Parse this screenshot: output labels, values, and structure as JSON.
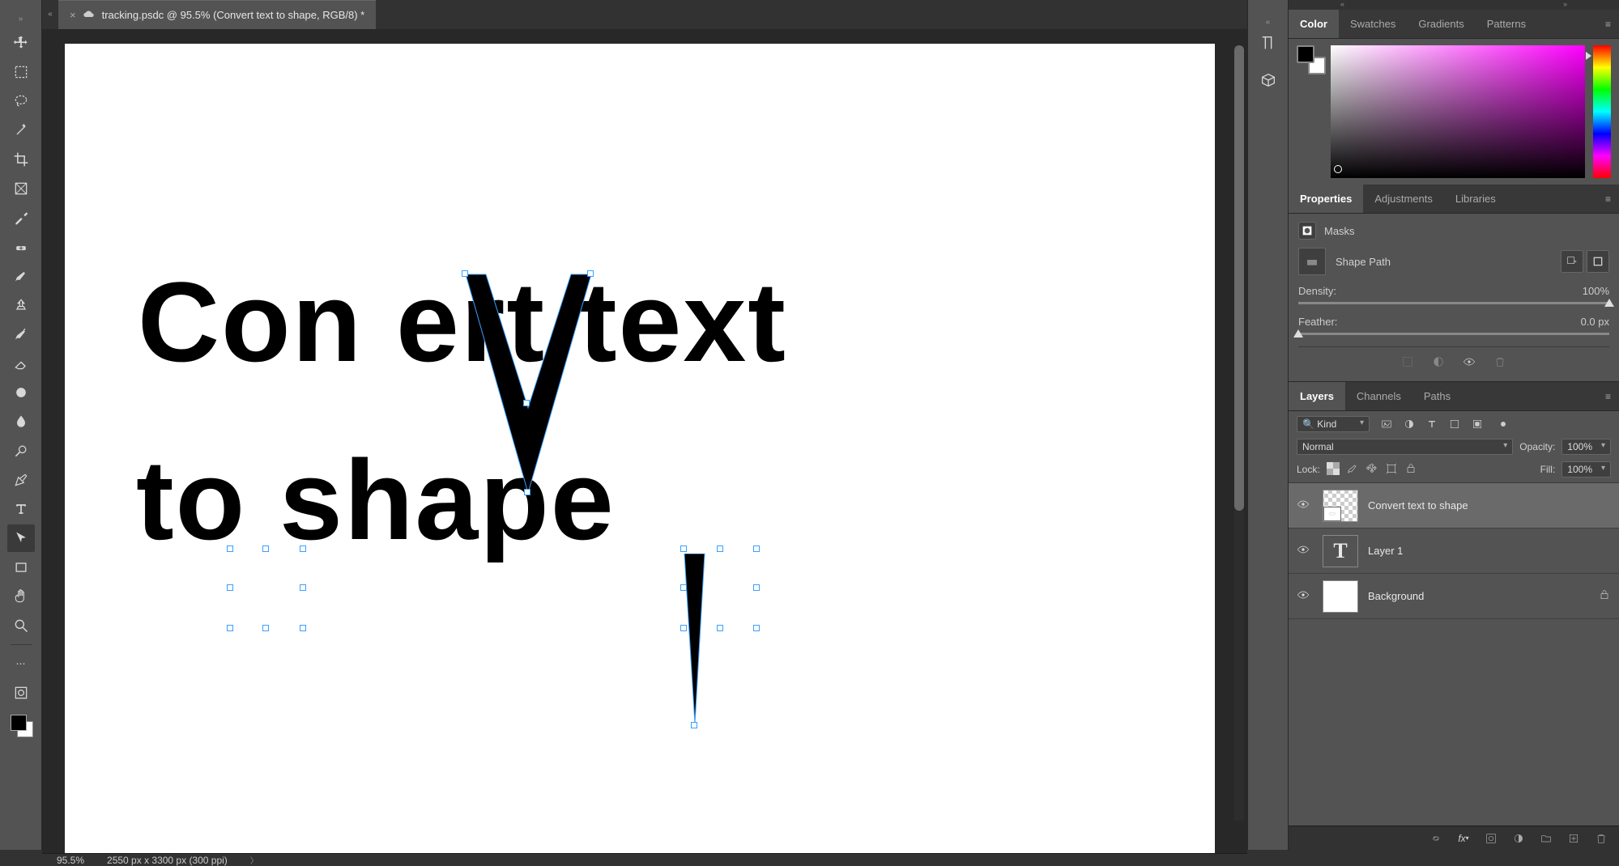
{
  "document": {
    "tab_title": "tracking.psdc @ 95.5% (Convert text to shape, RGB/8) *",
    "zoom": "95.5%",
    "dimensions": "2550 px x 3300 px (300 ppi)"
  },
  "canvas_text": {
    "line1": "Con   ert  text",
    "line2": "to  shape",
    "big_v": "V"
  },
  "color_panel": {
    "tabs": [
      "Color",
      "Swatches",
      "Gradients",
      "Patterns"
    ],
    "active": "Color"
  },
  "properties_panel": {
    "tabs": [
      "Properties",
      "Adjustments",
      "Libraries"
    ],
    "active": "Properties",
    "section": "Masks",
    "shape_label": "Shape Path",
    "density": {
      "label": "Density:",
      "value": "100%"
    },
    "feather": {
      "label": "Feather:",
      "value": "0.0 px"
    }
  },
  "layers_panel": {
    "tabs": [
      "Layers",
      "Channels",
      "Paths"
    ],
    "active": "Layers",
    "kind_label": "Kind",
    "blend_mode": "Normal",
    "opacity": {
      "label": "Opacity:",
      "value": "100%"
    },
    "lock_label": "Lock:",
    "fill": {
      "label": "Fill:",
      "value": "100%"
    },
    "layers": [
      {
        "name": "Convert text to shape",
        "kind": "shape",
        "selected": true,
        "visible": true
      },
      {
        "name": "Layer 1",
        "kind": "text",
        "selected": false,
        "visible": true
      },
      {
        "name": "Background",
        "kind": "bg",
        "selected": false,
        "visible": true,
        "locked": true
      }
    ]
  },
  "search_placeholder": "Kind"
}
